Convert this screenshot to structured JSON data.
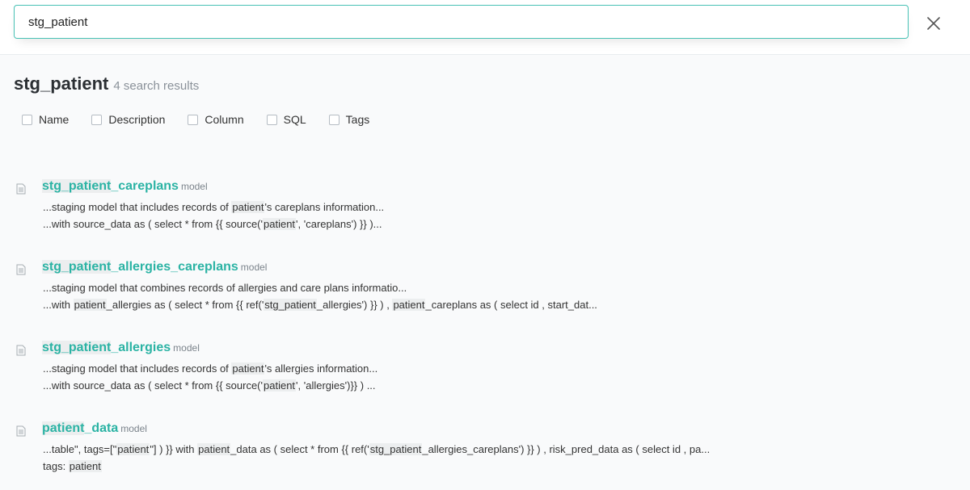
{
  "search": {
    "value": "stg_patient",
    "placeholder": ""
  },
  "header": {
    "title": "stg_patient",
    "count_text": "4 search results"
  },
  "filters": [
    {
      "label": "Name",
      "checked": false
    },
    {
      "label": "Description",
      "checked": false
    },
    {
      "label": "Column",
      "checked": false
    },
    {
      "label": "SQL",
      "checked": false
    },
    {
      "label": "Tags",
      "checked": false
    }
  ],
  "results": [
    {
      "name_hl": "stg_patient",
      "name_rest": "_careplans",
      "type": "model",
      "line1": [
        {
          "t": "...staging model that includes records of "
        },
        {
          "t": "patient",
          "hl": true
        },
        {
          "t": "'s careplans information..."
        }
      ],
      "line2": [
        {
          "t": "...with source_data as ( select * from {{ source('"
        },
        {
          "t": "patient",
          "hl": true
        },
        {
          "t": "', 'careplans') }} )..."
        }
      ]
    },
    {
      "name_hl": "stg_patient",
      "name_rest": "_allergies_careplans",
      "type": "model",
      "line1": [
        {
          "t": "...staging model that combines records of allergies and care plans informatio..."
        }
      ],
      "line2": [
        {
          "t": "...with "
        },
        {
          "t": "patient",
          "hl": true
        },
        {
          "t": "_allergies as ( select * from {{ ref('"
        },
        {
          "t": "stg_patient",
          "hl": true
        },
        {
          "t": "_allergies') }} ) , "
        },
        {
          "t": "patient",
          "hl": true
        },
        {
          "t": "_careplans as ( select id , start_dat..."
        }
      ]
    },
    {
      "name_hl": "stg_patient",
      "name_rest": "_allergies",
      "type": "model",
      "line1": [
        {
          "t": "...staging model that includes records of "
        },
        {
          "t": "patient",
          "hl": true
        },
        {
          "t": "'s allergies information..."
        }
      ],
      "line2": [
        {
          "t": "...with source_data as ( select * from {{ source('"
        },
        {
          "t": "patient",
          "hl": true
        },
        {
          "t": "', 'allergies')}} ) ..."
        }
      ]
    },
    {
      "name_hl": "patient",
      "name_rest": "_data",
      "type": "model",
      "line1": [
        {
          "t": "...table\", tags=[\""
        },
        {
          "t": "patient",
          "hl": true
        },
        {
          "t": "\"] ) }} with "
        },
        {
          "t": "patient",
          "hl": true
        },
        {
          "t": "_data as ( select * from {{ ref('"
        },
        {
          "t": "stg_patient",
          "hl": true
        },
        {
          "t": "_allergies_careplans') }} ) , risk_pred_data as ( select id , pa..."
        }
      ],
      "line2": [
        {
          "t": "tags: "
        },
        {
          "t": "patient",
          "hl": true
        }
      ]
    }
  ],
  "icons": {
    "close": "close-icon",
    "result": "document-icon"
  },
  "colors": {
    "accent": "#2bb3a4",
    "input_border": "#47c1b4",
    "highlight_bg": "#eceeef"
  }
}
